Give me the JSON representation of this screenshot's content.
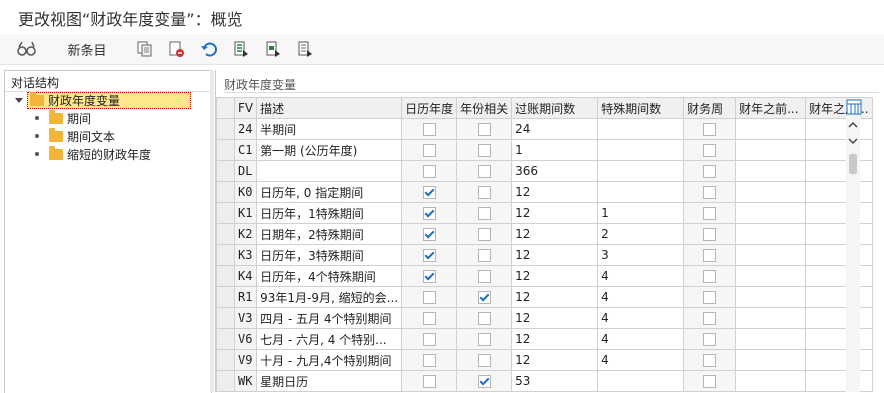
{
  "window": {
    "title": "更改视图“财政年度变量”：概览"
  },
  "toolbar": {
    "new_entries": "新条目"
  },
  "left_panel": {
    "title": "对话结构",
    "root": "财政年度变量",
    "children": [
      "期间",
      "期间文本",
      "缩短的财政年度"
    ]
  },
  "right_panel": {
    "group_title": "财政年度变量",
    "columns": [
      "FV",
      "描述",
      "日历年度",
      "年份相关",
      "过账期间数",
      "特殊期间数",
      "财务周",
      "财年之前...",
      "财年之后..."
    ],
    "rows": [
      {
        "fv": "24",
        "desc": "半期间",
        "cal": false,
        "yr": false,
        "post": "24",
        "spec": "",
        "fw": false
      },
      {
        "fv": "C1",
        "desc": "第一期 (公历年度)",
        "cal": false,
        "yr": false,
        "post": "1",
        "spec": "",
        "fw": false
      },
      {
        "fv": "DL",
        "desc": "",
        "cal": false,
        "yr": false,
        "post": "366",
        "spec": "",
        "fw": false
      },
      {
        "fv": "K0",
        "desc": "日历年, 0 指定期间",
        "cal": true,
        "yr": false,
        "post": "12",
        "spec": "",
        "fw": false
      },
      {
        "fv": "K1",
        "desc": "日历年，1特殊期间",
        "cal": true,
        "yr": false,
        "post": "12",
        "spec": "1",
        "fw": false
      },
      {
        "fv": "K2",
        "desc": "日期年，2特殊期间",
        "cal": true,
        "yr": false,
        "post": "12",
        "spec": "2",
        "fw": false
      },
      {
        "fv": "K3",
        "desc": "日历年，3特殊期间",
        "cal": true,
        "yr": false,
        "post": "12",
        "spec": "3",
        "fw": false
      },
      {
        "fv": "K4",
        "desc": "日历年，4个特殊期间",
        "cal": true,
        "yr": false,
        "post": "12",
        "spec": "4",
        "fw": false
      },
      {
        "fv": "R1",
        "desc": "93年1月-9月, 缩短的会...",
        "cal": false,
        "yr": true,
        "post": "12",
        "spec": "4",
        "fw": false
      },
      {
        "fv": "V3",
        "desc": "四月 - 五月 4个特别期间",
        "cal": false,
        "yr": false,
        "post": "12",
        "spec": "4",
        "fw": false
      },
      {
        "fv": "V6",
        "desc": "七月 - 六月, 4 个特别...",
        "cal": false,
        "yr": false,
        "post": "12",
        "spec": "4",
        "fw": false
      },
      {
        "fv": "V9",
        "desc": "十月 - 九月,4个特别期间",
        "cal": false,
        "yr": false,
        "post": "12",
        "spec": "4",
        "fw": false
      },
      {
        "fv": "WK",
        "desc": "星期日历",
        "cal": false,
        "yr": true,
        "post": "53",
        "spec": "",
        "fw": false
      }
    ]
  },
  "colors": {
    "folder": "#f3b43a",
    "selected_bg": "#ffe68a",
    "check": "#1d6fc1"
  },
  "icons": [
    "glasses-icon",
    "copy-icon",
    "delete-icon",
    "undo-icon",
    "select-all-icon",
    "select-block-icon",
    "deselect-icon",
    "table-settings-icon"
  ]
}
